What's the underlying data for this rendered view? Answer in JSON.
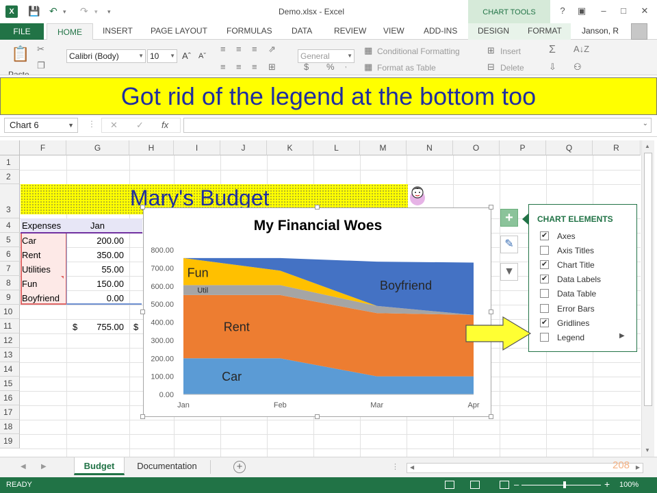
{
  "window": {
    "title": "Demo.xlsx - Excel",
    "app_icon": "X",
    "context_tab": "CHART TOOLS",
    "help": "?",
    "user": "Janson, R"
  },
  "ribbon_tabs": [
    "FILE",
    "HOME",
    "INSERT",
    "PAGE LAYOUT",
    "FORMULAS",
    "DATA",
    "REVIEW",
    "VIEW",
    "ADD-INS",
    "DESIGN",
    "FORMAT"
  ],
  "ribbon": {
    "font_name": "Calibri (Body)",
    "font_size": "10",
    "number_format": "General",
    "conditional_formatting": "Conditional Formatting",
    "format_as_table": "Format as Table",
    "insert": "Insert",
    "delete": "Delete",
    "paste": "Paste"
  },
  "banner": "Got rid of the legend at the bottom too",
  "formula_bar": {
    "name_box": "Chart 6",
    "fx": "fx",
    "formula": ""
  },
  "columns": [
    "F",
    "G",
    "H",
    "I",
    "J",
    "K",
    "L",
    "M",
    "N",
    "O",
    "P",
    "Q",
    "R"
  ],
  "rows": [
    "1",
    "2",
    "3",
    "4",
    "5",
    "6",
    "7",
    "8",
    "9",
    "10",
    "11",
    "12",
    "13",
    "14",
    "15",
    "16",
    "17",
    "18",
    "19"
  ],
  "sheet": {
    "title": "Mary's Budget",
    "header_expenses": "Expenses",
    "header_jan": "Jan",
    "expenses": [
      {
        "name": "Car",
        "jan": "200.00"
      },
      {
        "name": "Rent",
        "jan": "350.00"
      },
      {
        "name": "Utilities",
        "jan": "55.00"
      },
      {
        "name": "Fun",
        "jan": "150.00"
      },
      {
        "name": "Boyfriend",
        "jan": "0.00"
      }
    ],
    "total_currency": "$",
    "total_jan": "755.00",
    "total_next_currency": "$"
  },
  "chart_data": {
    "type": "area",
    "stacked": true,
    "title": "My Financial Woes",
    "categories": [
      "Jan",
      "Feb",
      "Mar",
      "Apr"
    ],
    "series": [
      {
        "name": "Car",
        "values": [
          200,
          200,
          100,
          100
        ],
        "color": "#5b9bd5"
      },
      {
        "name": "Rent",
        "values": [
          350,
          350,
          350,
          340
        ],
        "color": "#ed7d31"
      },
      {
        "name": "Util",
        "values": [
          55,
          55,
          40,
          0
        ],
        "color": "#a5a5a5"
      },
      {
        "name": "Fun",
        "values": [
          150,
          80,
          0,
          0
        ],
        "color": "#ffc000"
      },
      {
        "name": "Boyfriend",
        "values": [
          0,
          70,
          245,
          290
        ],
        "color": "#4472c4"
      }
    ],
    "yticks": [
      "0.00",
      "100.00",
      "200.00",
      "300.00",
      "400.00",
      "500.00",
      "600.00",
      "700.00",
      "800.00"
    ],
    "ylim": [
      0,
      800
    ],
    "grid": false,
    "legend": "none"
  },
  "chart_elements": {
    "title": "CHART ELEMENTS",
    "items": [
      {
        "label": "Axes",
        "checked": true,
        "mark": "✔"
      },
      {
        "label": "Axis Titles",
        "checked": false,
        "mark": ""
      },
      {
        "label": "Chart Title",
        "checked": true,
        "mark": "✔"
      },
      {
        "label": "Data Labels",
        "checked": true,
        "mark": "✔"
      },
      {
        "label": "Data Table",
        "checked": false,
        "mark": ""
      },
      {
        "label": "Error Bars",
        "checked": false,
        "mark": ""
      },
      {
        "label": "Gridlines",
        "checked": true,
        "mark": "✔"
      },
      {
        "label": "Legend",
        "checked": false,
        "mark": ""
      }
    ]
  },
  "sheet_tabs": [
    "Budget",
    "Documentation"
  ],
  "slide_number": "208",
  "status": {
    "ready": "READY",
    "zoom": "100%"
  },
  "colors": {
    "excel_green": "#217346",
    "banner_yellow": "#ffff00",
    "banner_text": "#1f2ea0",
    "arrow_yellow": "#ffff33"
  }
}
